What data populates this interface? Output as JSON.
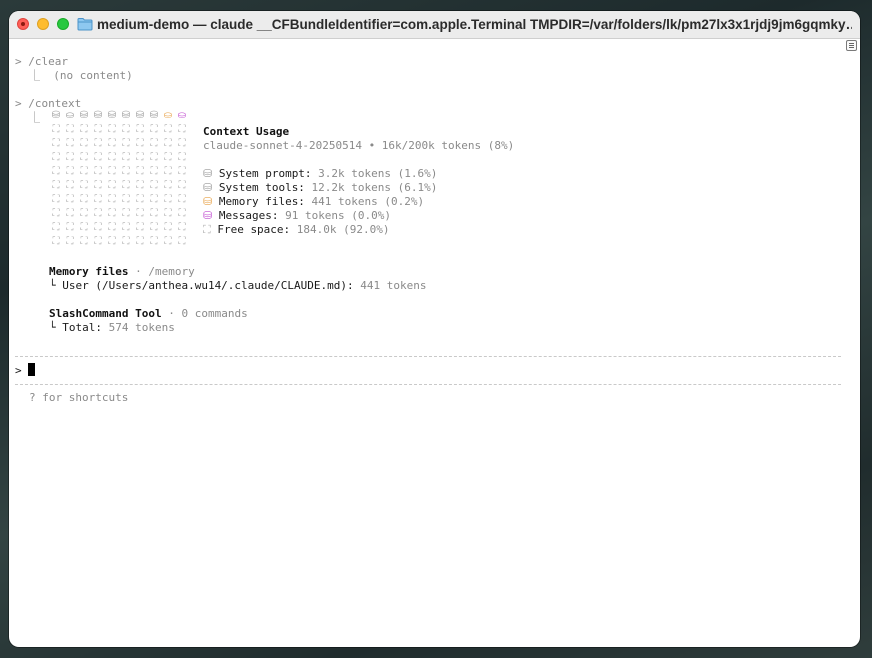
{
  "window": {
    "title": "medium-demo — claude __CFBundleIdentifier=com.apple.Terminal TMPDIR=/var/folders/lk/pm27lx3x1rjdj9jm6gqmky…"
  },
  "terminal": {
    "prompt_symbol": ">",
    "cmd_clear": "/clear",
    "clear_output": "⎿  (no content)",
    "cmd_context": "/context",
    "context_branch": "⎿",
    "grid_colors": {
      "used": "#9a9a9a",
      "memory": "#e8a34a",
      "messages": "#c24fd1",
      "free": "#b0b0b0"
    },
    "grid_rows": [
      [
        "⛁",
        "⛀",
        "⛁",
        "⛁",
        "⛁",
        "⛁",
        "⛁",
        "⛁",
        "⛀",
        "⛀"
      ],
      [
        "⛶",
        "⛶",
        "⛶",
        "⛶",
        "⛶",
        "⛶",
        "⛶",
        "⛶",
        "⛶",
        "⛶"
      ],
      [
        "⛶",
        "⛶",
        "⛶",
        "⛶",
        "⛶",
        "⛶",
        "⛶",
        "⛶",
        "⛶",
        "⛶"
      ],
      [
        "⛶",
        "⛶",
        "⛶",
        "⛶",
        "⛶",
        "⛶",
        "⛶",
        "⛶",
        "⛶",
        "⛶"
      ],
      [
        "⛶",
        "⛶",
        "⛶",
        "⛶",
        "⛶",
        "⛶",
        "⛶",
        "⛶",
        "⛶",
        "⛶"
      ],
      [
        "⛶",
        "⛶",
        "⛶",
        "⛶",
        "⛶",
        "⛶",
        "⛶",
        "⛶",
        "⛶",
        "⛶"
      ],
      [
        "⛶",
        "⛶",
        "⛶",
        "⛶",
        "⛶",
        "⛶",
        "⛶",
        "⛶",
        "⛶",
        "⛶"
      ],
      [
        "⛶",
        "⛶",
        "⛶",
        "⛶",
        "⛶",
        "⛶",
        "⛶",
        "⛶",
        "⛶",
        "⛶"
      ],
      [
        "⛶",
        "⛶",
        "⛶",
        "⛶",
        "⛶",
        "⛶",
        "⛶",
        "⛶",
        "⛶",
        "⛶"
      ],
      [
        "⛶",
        "⛶",
        "⛶",
        "⛶",
        "⛶",
        "⛶",
        "⛶",
        "⛶",
        "⛶",
        "⛶"
      ]
    ],
    "usage_title": "Context Usage",
    "usage_model": "claude-sonnet-4-20250514 • 16k/200k tokens (8%)",
    "usage_items": [
      {
        "icon": "⛁",
        "label": "System prompt:",
        "value": "3.2k tokens (1.6%)"
      },
      {
        "icon": "⛁",
        "label": "System tools:",
        "value": "12.2k tokens (6.1%)"
      },
      {
        "icon": "⛁",
        "label": "Memory files:",
        "value": "441 tokens (0.2%)"
      },
      {
        "icon": "⛁",
        "label": "Messages:",
        "value": "91 tokens (0.0%)"
      },
      {
        "icon": "⛶",
        "label": "Free space:",
        "value": "184.0k (92.0%)"
      }
    ],
    "memory_title": "Memory files",
    "memory_sub": " · /memory",
    "memory_line_label": "└ User (/Users/anthea.wu14/.claude/CLAUDE.md):",
    "memory_line_value": " 441 tokens",
    "slash_title": "SlashCommand Tool",
    "slash_sub": " · 0 commands",
    "slash_line_label": "└ Total:",
    "slash_line_value": " 574 tokens",
    "input_prompt": ">",
    "hint": "? for shortcuts"
  }
}
